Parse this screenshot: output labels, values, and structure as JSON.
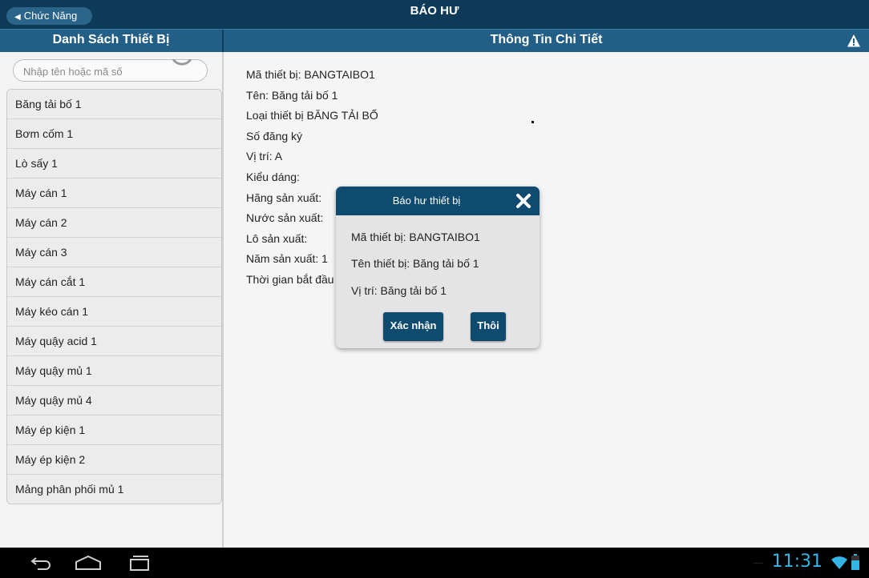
{
  "topbar": {
    "back_label": "Chức Năng",
    "title": "BÁO HƯ"
  },
  "subbar": {
    "left_title": "Danh Sách Thiết Bị",
    "right_title": "Thông Tin Chi Tiết",
    "warning_icon": "warning-icon"
  },
  "search": {
    "placeholder": "Nhập tên hoặc mã số",
    "icon": "search-icon"
  },
  "devices": [
    "Băng tải bố 1",
    "Bơm cốm 1",
    "Lò sấy 1",
    "Máy cán 1",
    "Máy cán 2",
    "Máy cán 3",
    "Máy cán cắt 1",
    "Máy kéo cán 1",
    "Máy quậy acid 1",
    "Máy quậy mủ 1",
    "Máy quậy mủ 4",
    "Máy ép kiện 1",
    "Máy ép kiện 2",
    "Mảng phân phối mủ 1"
  ],
  "detail": {
    "lines": [
      "Mã thiết bị: BANGTAIBO1",
      "Tên: Băng tải bố 1",
      "Loại thiết bị BĂNG TẢI BỐ",
      "Số đăng ký",
      "Vị trí: A",
      "Kiểu dáng:",
      "Hãng sản xuất:",
      "Nước sản xuất:",
      "Lô sản xuất:",
      "Năm sản xuất: 1",
      "Thời gian bắt đầu s"
    ]
  },
  "dialog": {
    "title": "Báo hư thiết bị",
    "code_line": "Mã thiết bị: BANGTAIBO1",
    "name_line": "Tên thiết bị: Băng tải bố 1",
    "location_line": "Vị trí: Băng tải bố 1",
    "confirm_label": "Xác nhận",
    "cancel_label": "Thôi"
  },
  "status": {
    "time": "11:31"
  },
  "colors": {
    "topbar": "#0d3b57",
    "subbar": "#235e86",
    "accent_clock": "#33b5e5",
    "dialog_header": "#0f4a6f"
  }
}
